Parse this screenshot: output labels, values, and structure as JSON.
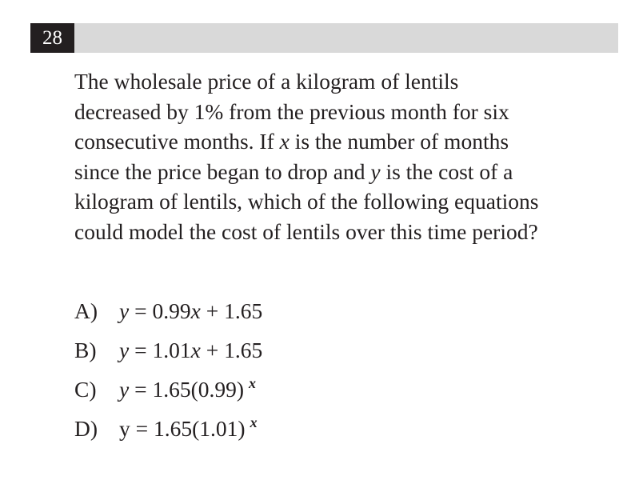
{
  "question": {
    "number": "28",
    "stem_lines": [
      {
        "text": "The wholesale price of a kilogram of lentils"
      },
      {
        "text": "decreased by 1% from the previous month for six"
      },
      {
        "a": "consecutive months. If ",
        "v1": "x",
        "b": " is the number of months"
      },
      {
        "a": "since the price began to drop and ",
        "v1": "y",
        "b": " is the cost of a"
      },
      {
        "text": "kilogram of lentils, which of the following equations"
      },
      {
        "text": "could model the cost of lentils over this time period?"
      }
    ]
  },
  "choices": [
    {
      "letter": "A)",
      "y": "y",
      "eq1": " = 0.99",
      "x": "x",
      "eq2": " + 1.65"
    },
    {
      "letter": "B)",
      "y": "y",
      "eq1": " = 1.01",
      "x": "x",
      "eq2": " + 1.65"
    },
    {
      "letter": "C)",
      "y": "y",
      "eq1": " = 1.65(0.99)",
      "exp": "x"
    },
    {
      "letter": "D)",
      "y": "y",
      "eq1": " = 1.65(1.01)",
      "exp": "x"
    }
  ]
}
